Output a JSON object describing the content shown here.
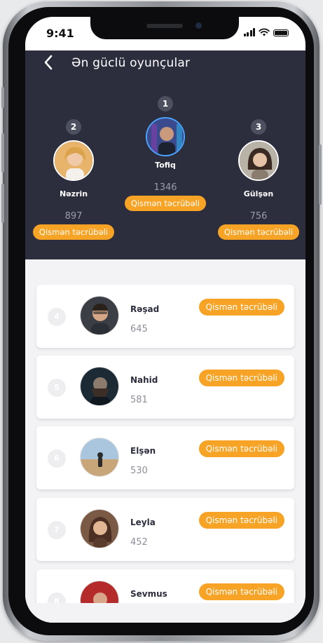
{
  "status": {
    "time": "9:41"
  },
  "header": {
    "title": "Ən güclü oyunçular"
  },
  "badge_label": "Qismən təcrübəli",
  "podium": [
    {
      "rank": "1",
      "name": "Tofiq",
      "score": "1346"
    },
    {
      "rank": "2",
      "name": "Nəzrin",
      "score": "897"
    },
    {
      "rank": "3",
      "name": "Gülşən",
      "score": "756"
    }
  ],
  "list": [
    {
      "rank": "4",
      "name": "Rəşad",
      "score": "645"
    },
    {
      "rank": "5",
      "name": "Nahid",
      "score": "581"
    },
    {
      "rank": "6",
      "name": "Elşən",
      "score": "530"
    },
    {
      "rank": "7",
      "name": "Leyla",
      "score": "452"
    },
    {
      "rank": "8",
      "name": "Sevmus",
      "score": ""
    }
  ],
  "colors": {
    "header_bg": "#2c2e3e",
    "badge": "#f7a325",
    "list_bg": "#f3f3f5"
  }
}
